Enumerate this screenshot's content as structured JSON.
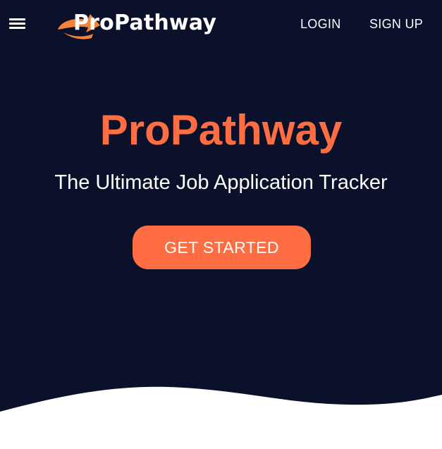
{
  "header": {
    "menu_icon": "hamburger-menu-icon",
    "logo": {
      "text": "ProPathway",
      "icon": "swoosh-arrow-logo",
      "mark_color": "#f2843a"
    },
    "nav": {
      "login_label": "LOGIN",
      "signup_label": "SIGN UP"
    }
  },
  "hero": {
    "title": "ProPathway",
    "subtitle": "The Ultimate Job Application Tracker",
    "cta_label": "GET STARTED"
  },
  "colors": {
    "background": "#0b102b",
    "accent": "#ff6e42",
    "text": "#ffffff",
    "wave": "#ffffff"
  }
}
